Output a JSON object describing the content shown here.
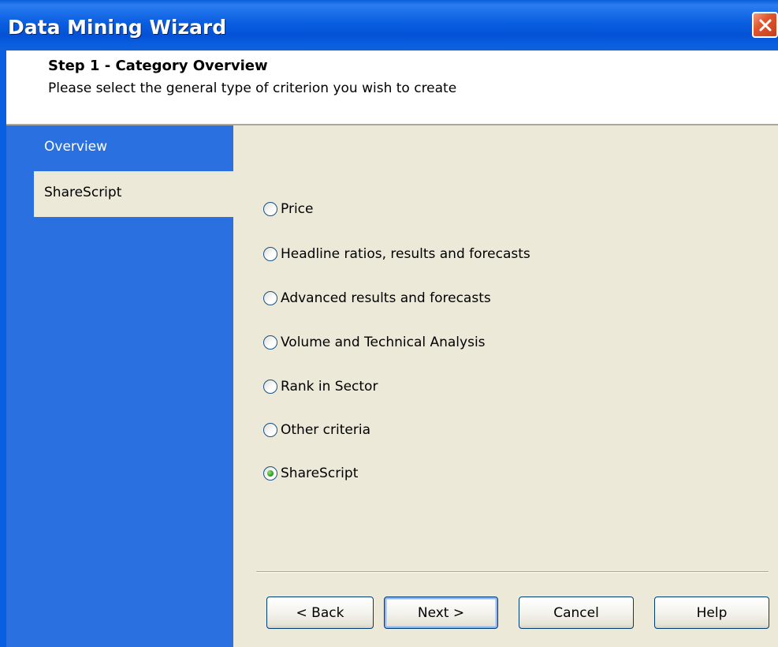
{
  "window": {
    "title": "Data Mining Wizard"
  },
  "header": {
    "step_title": "Step 1 - Category Overview",
    "step_subtitle": "Please select the general type of criterion you wish to create"
  },
  "sidebar": {
    "items": [
      {
        "label": "Overview",
        "selected": false
      },
      {
        "label": "ShareScript",
        "selected": true
      }
    ]
  },
  "options": {
    "selected": "ShareScript",
    "items": [
      {
        "label": "Price"
      },
      {
        "label": "Headline ratios, results and forecasts"
      },
      {
        "label": "Advanced results and forecasts"
      },
      {
        "label": "Volume and Technical Analysis"
      },
      {
        "label": "Rank in Sector"
      },
      {
        "label": "Other criteria"
      },
      {
        "label": "ShareScript"
      }
    ]
  },
  "buttons": {
    "back": "< Back",
    "next": "Next >",
    "cancel": "Cancel",
    "help": "Help"
  },
  "colors": {
    "titlebar": "#0a5ee0",
    "sidebar": "#2a70e0",
    "dialog_bg": "#ece9d8",
    "close_button": "#e0562e",
    "radio_selected_dot": "#2fa01e"
  },
  "icons": {
    "close": "close-icon"
  }
}
